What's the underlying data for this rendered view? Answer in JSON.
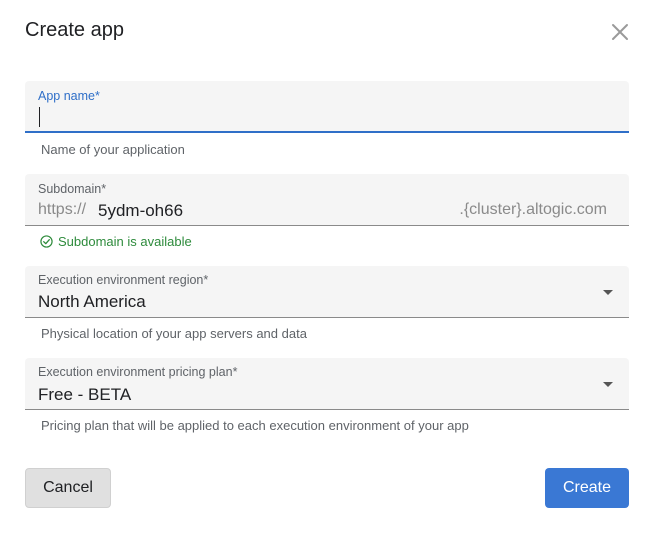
{
  "dialog": {
    "title": "Create app"
  },
  "app_name": {
    "label": "App name",
    "required_mark": "*",
    "value": "",
    "helper": "Name of your application"
  },
  "subdomain": {
    "label": "Subdomain",
    "required_mark": "*",
    "prefix": "https://",
    "value": "5ydm-oh66",
    "suffix": ".{cluster}.altogic.com",
    "status": "Subdomain is available",
    "status_color": "#2e8b3c"
  },
  "region": {
    "label": "Execution environment region",
    "required_mark": "*",
    "selected": "North America",
    "helper": "Physical location of your app servers and data"
  },
  "plan": {
    "label": "Execution environment pricing plan",
    "required_mark": "*",
    "selected": "Free - BETA",
    "helper": "Pricing plan that will be applied to each execution environment of your app"
  },
  "actions": {
    "cancel_label": "Cancel",
    "create_label": "Create"
  },
  "colors": {
    "accent": "#3a78d4",
    "success": "#2e8b3c"
  },
  "icons": {
    "close": "close-icon",
    "check": "check-circle-icon",
    "dropdown": "chevron-down-icon"
  }
}
